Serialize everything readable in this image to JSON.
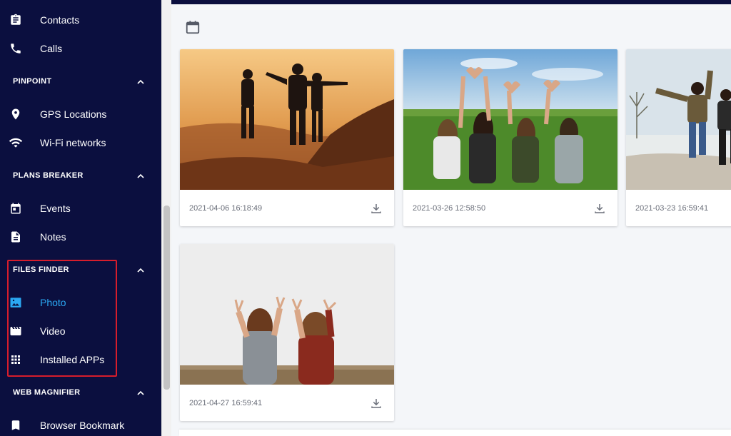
{
  "sidebar": {
    "items_top": [
      {
        "label": "Contacts",
        "icon": "clipboard-icon"
      },
      {
        "label": "Calls",
        "icon": "phone-icon"
      }
    ],
    "sections": {
      "pinpoint": {
        "title": "PINPOINT",
        "items": [
          {
            "label": "GPS Locations",
            "icon": "location-pin-icon"
          },
          {
            "label": "Wi-Fi networks",
            "icon": "wifi-icon"
          }
        ]
      },
      "plans_breaker": {
        "title": "PLANS BREAKER",
        "items": [
          {
            "label": "Events",
            "icon": "calendar-event-icon"
          },
          {
            "label": "Notes",
            "icon": "note-icon"
          }
        ]
      },
      "files_finder": {
        "title": "FILES FINDER",
        "items": [
          {
            "label": "Photo",
            "icon": "image-icon",
            "active": true
          },
          {
            "label": "Video",
            "icon": "clapperboard-icon"
          },
          {
            "label": "Installed APPs",
            "icon": "apps-grid-icon"
          }
        ]
      },
      "web_magnifier": {
        "title": "WEB MAGNIFIER",
        "items": [
          {
            "label": "Browser Bookmark",
            "icon": "bookmark-icon"
          }
        ]
      }
    }
  },
  "gallery": {
    "photos": [
      {
        "date": "2021-04-06 16:18:49"
      },
      {
        "date": "2021-03-26 12:58:50"
      },
      {
        "date": "2021-03-23 16:59:41"
      },
      {
        "date": "2021-04-27 16:59:41"
      }
    ]
  },
  "colors": {
    "sidebar_bg": "#0b0f3f",
    "active": "#2ba8f3",
    "highlight": "#d71d2c",
    "page_bg": "#f4f6f9"
  }
}
